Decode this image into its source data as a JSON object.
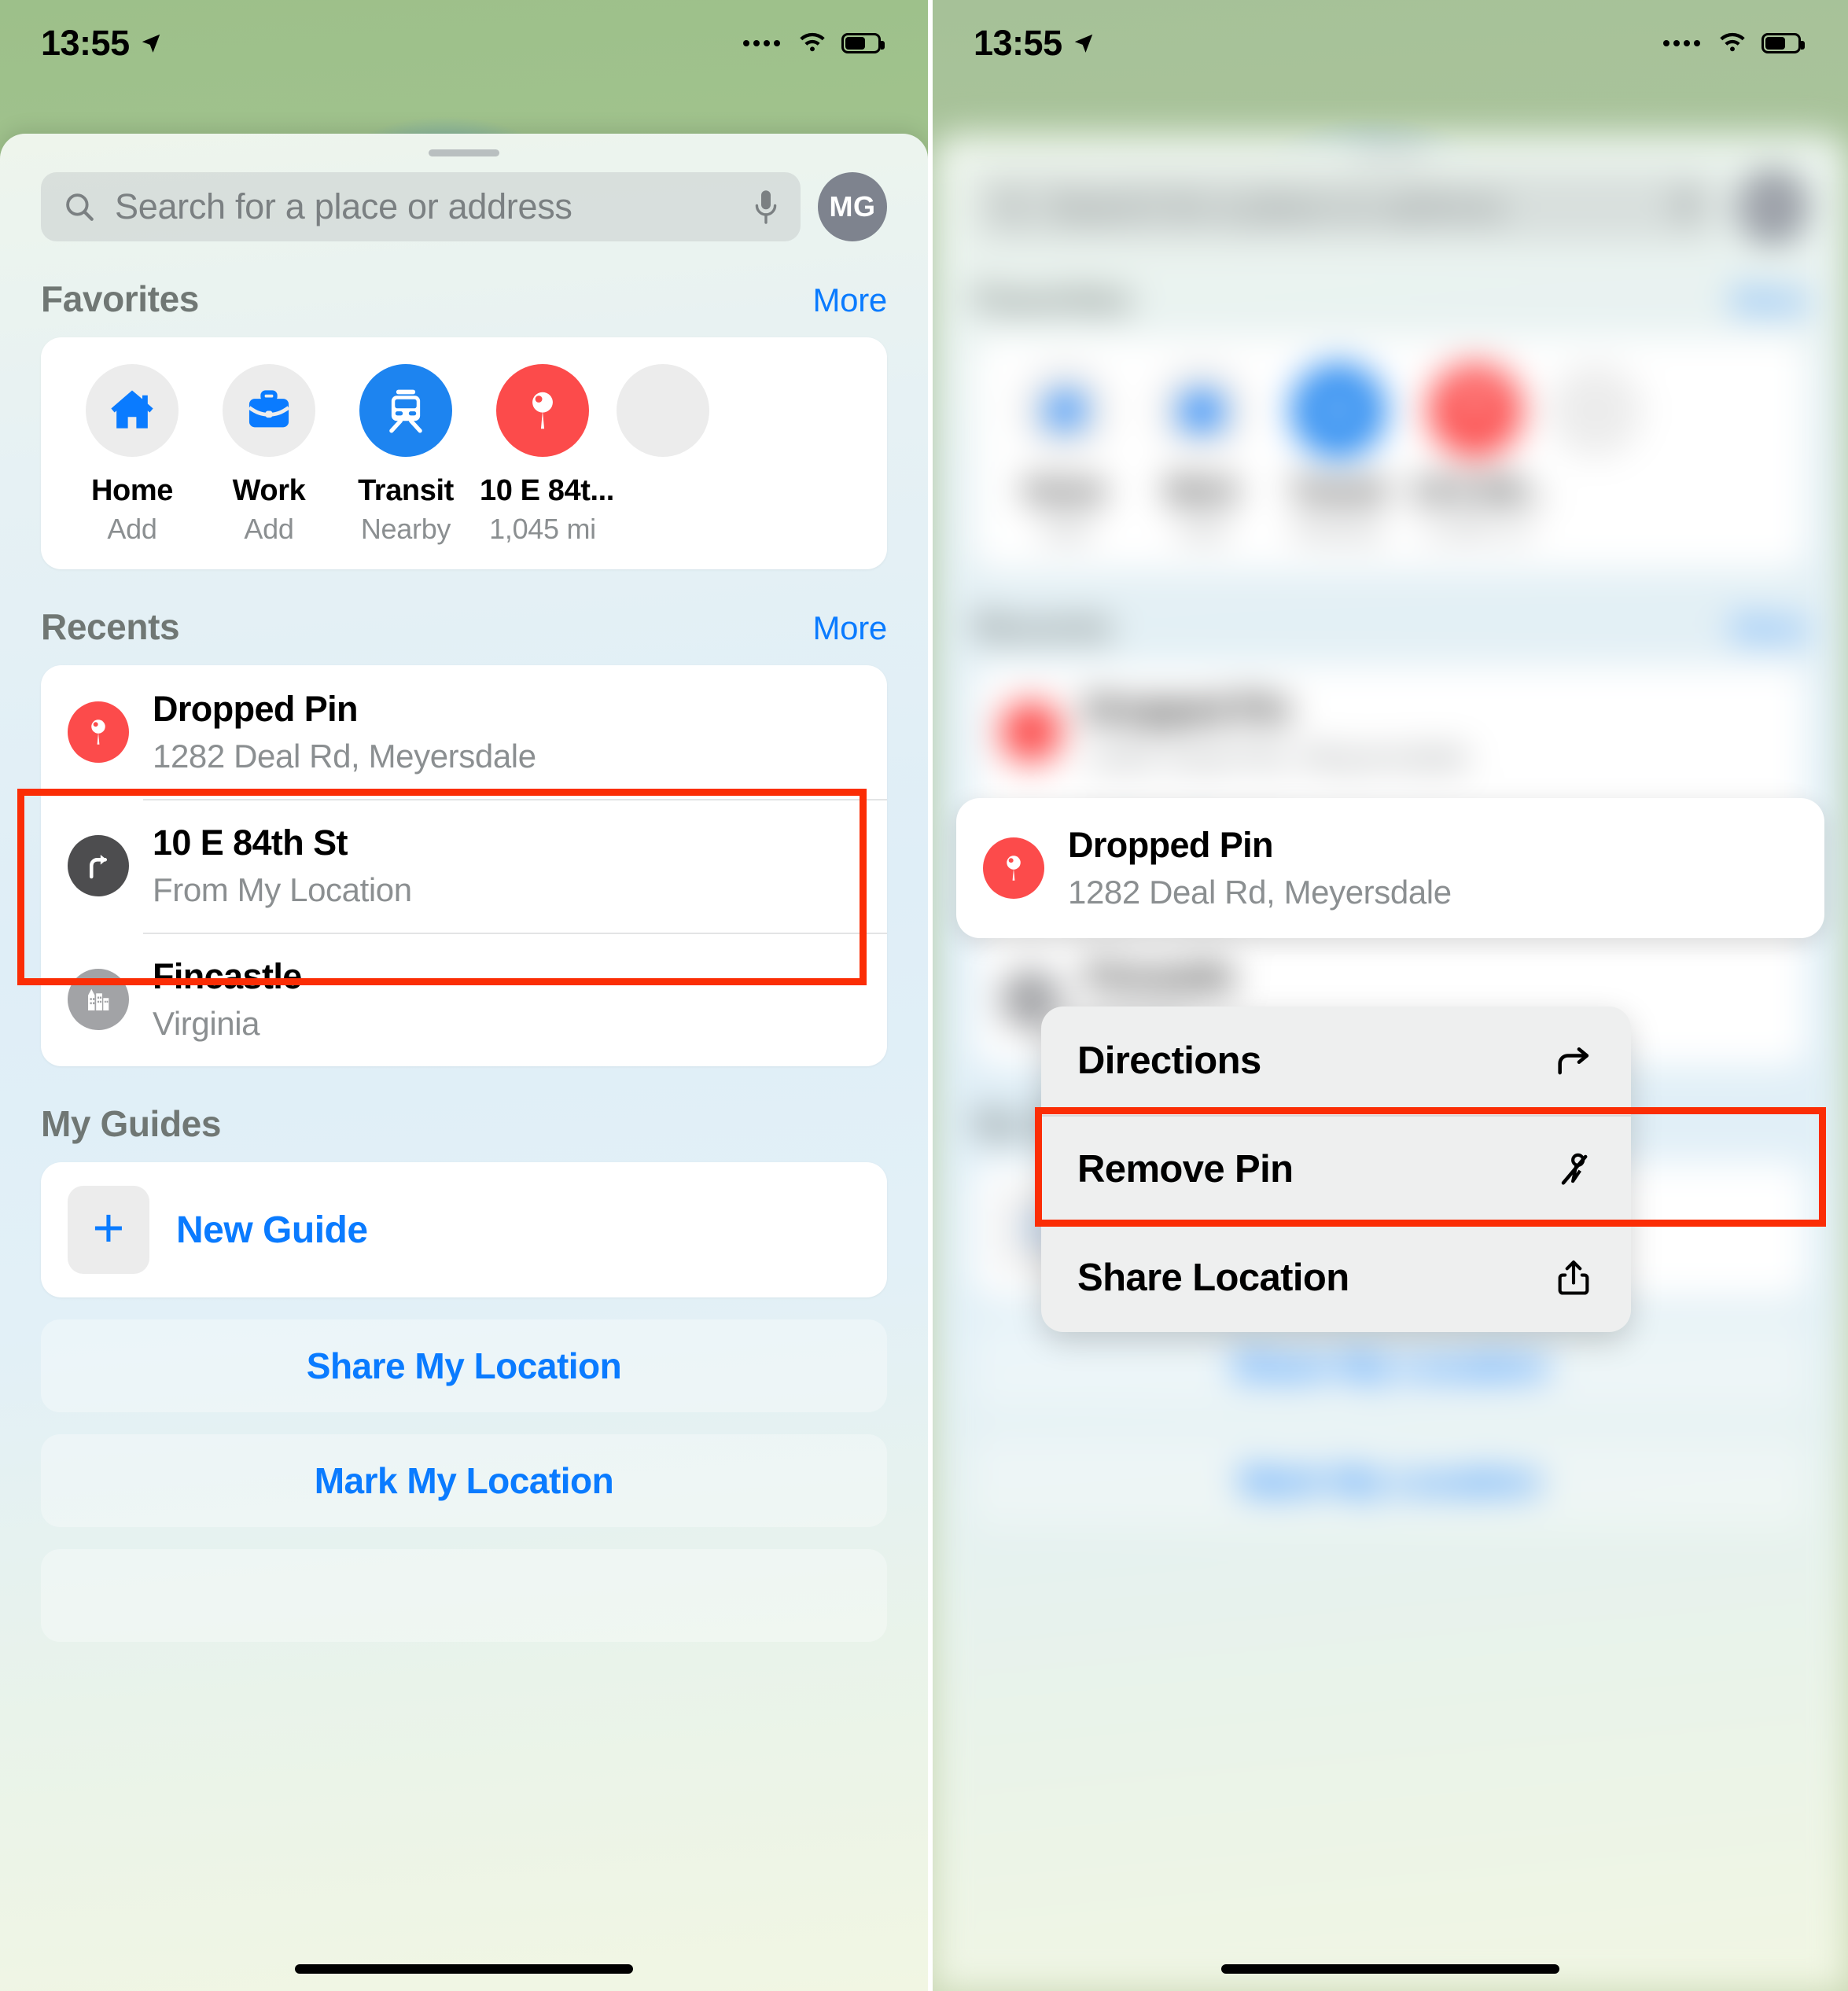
{
  "status_bar": {
    "time": "13:55",
    "location_arrow_icon": "location-arrow-icon",
    "cellular_dots_icon": "cellular-dots-icon",
    "wifi_icon": "wifi-icon",
    "battery_icon": "battery-icon"
  },
  "search": {
    "placeholder": "Search for a place or address",
    "search_icon": "search-icon",
    "mic_icon": "microphone-icon",
    "avatar_initials": "MG"
  },
  "favorites": {
    "title": "Favorites",
    "more_label": "More",
    "items": [
      {
        "label": "Home",
        "sub": "Add",
        "icon": "house-icon",
        "style": "grey"
      },
      {
        "label": "Work",
        "sub": "Add",
        "icon": "briefcase-icon",
        "style": "grey"
      },
      {
        "label": "Transit",
        "sub": "Nearby",
        "icon": "train-icon",
        "style": "blue"
      },
      {
        "label": "10 E 84t...",
        "sub": "1,045 mi",
        "icon": "map-pin-icon",
        "style": "red"
      }
    ]
  },
  "recents": {
    "title": "Recents",
    "more_label": "More",
    "items": [
      {
        "title": "Dropped Pin",
        "subtitle": "1282 Deal Rd, Meyersdale",
        "icon": "map-pin-icon",
        "style": "red"
      },
      {
        "title": "10 E 84th St",
        "subtitle": "From My Location",
        "icon": "turn-right-icon",
        "style": "dark"
      },
      {
        "title": "Fincastle",
        "subtitle": "Virginia",
        "icon": "city-buildings-icon",
        "style": "grey"
      }
    ]
  },
  "guides": {
    "title": "My Guides",
    "new_guide_label": "New Guide",
    "plus_icon": "plus-icon"
  },
  "bottom_buttons": [
    {
      "label": "Share My Location"
    },
    {
      "label": "Mark My Location"
    }
  ],
  "context_menu": {
    "pin_card": {
      "title": "Dropped Pin",
      "subtitle": "1282 Deal Rd, Meyersdale",
      "icon": "map-pin-icon"
    },
    "items": [
      {
        "label": "Directions",
        "icon": "directions-arrow-icon",
        "highlighted": false
      },
      {
        "label": "Remove Pin",
        "icon": "remove-pin-icon",
        "highlighted": true
      },
      {
        "label": "Share Location",
        "icon": "share-icon",
        "highlighted": false
      }
    ]
  },
  "colors": {
    "accent_blue": "#0a7bff",
    "pin_red": "#fc4b4b",
    "highlight_red": "#fb2d05",
    "transit_blue": "#1d84f0"
  }
}
